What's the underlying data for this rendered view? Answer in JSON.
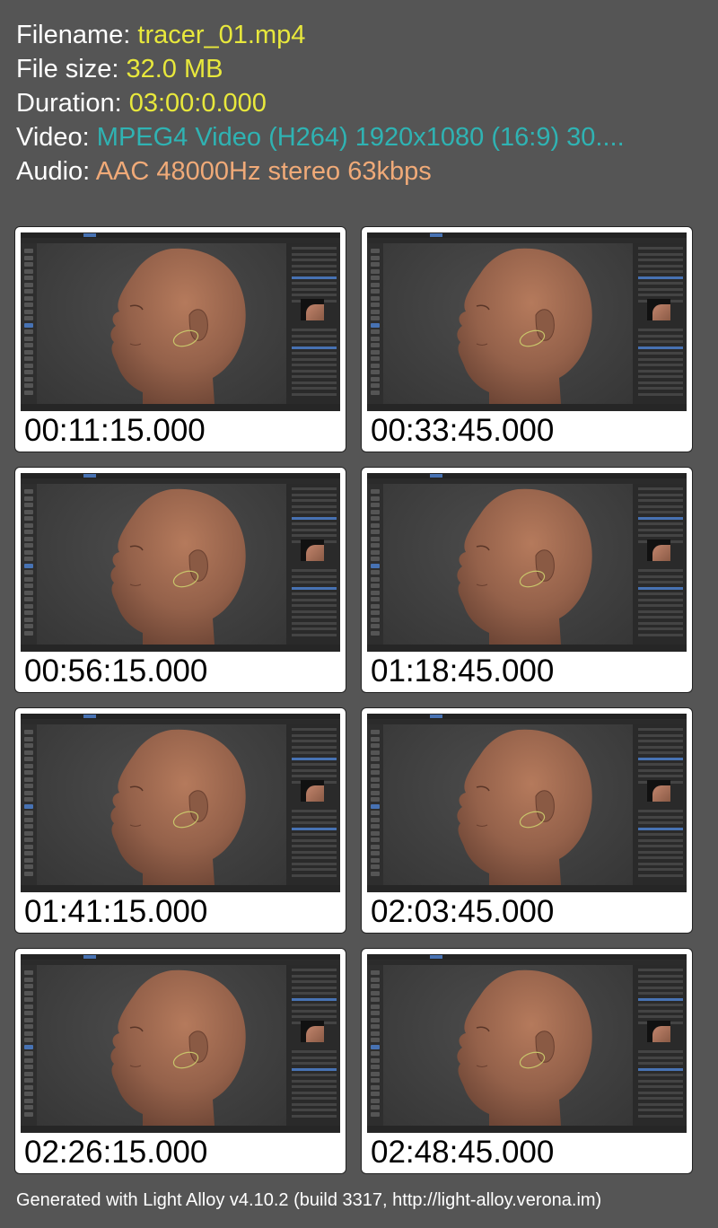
{
  "info": {
    "filename_label": "Filename:",
    "filename_value": "tracer_01.mp4",
    "filesize_label": "File size:",
    "filesize_value": "32.0 MB",
    "duration_label": "Duration:",
    "duration_value": "03:00:0.000",
    "video_label": "Video:",
    "video_value": "MPEG4 Video (H264) 1920x1080 (16:9) 30....",
    "audio_label": "Audio:",
    "audio_value": "AAC 48000Hz stereo 63kbps"
  },
  "colors": {
    "background": "#555555",
    "filename": "#e8e83c",
    "filesize": "#e8e83c",
    "duration": "#e8e83c",
    "video": "#2fb3b3",
    "audio": "#f0aa78"
  },
  "thumbnails": [
    {
      "timestamp": "00:11:15.000"
    },
    {
      "timestamp": "00:33:45.000"
    },
    {
      "timestamp": "00:56:15.000"
    },
    {
      "timestamp": "01:18:45.000"
    },
    {
      "timestamp": "01:41:15.000"
    },
    {
      "timestamp": "02:03:45.000"
    },
    {
      "timestamp": "02:26:15.000"
    },
    {
      "timestamp": "02:48:45.000"
    }
  ],
  "footer": "Generated with Light Alloy v4.10.2 (build 3317, http://light-alloy.verona.im)"
}
